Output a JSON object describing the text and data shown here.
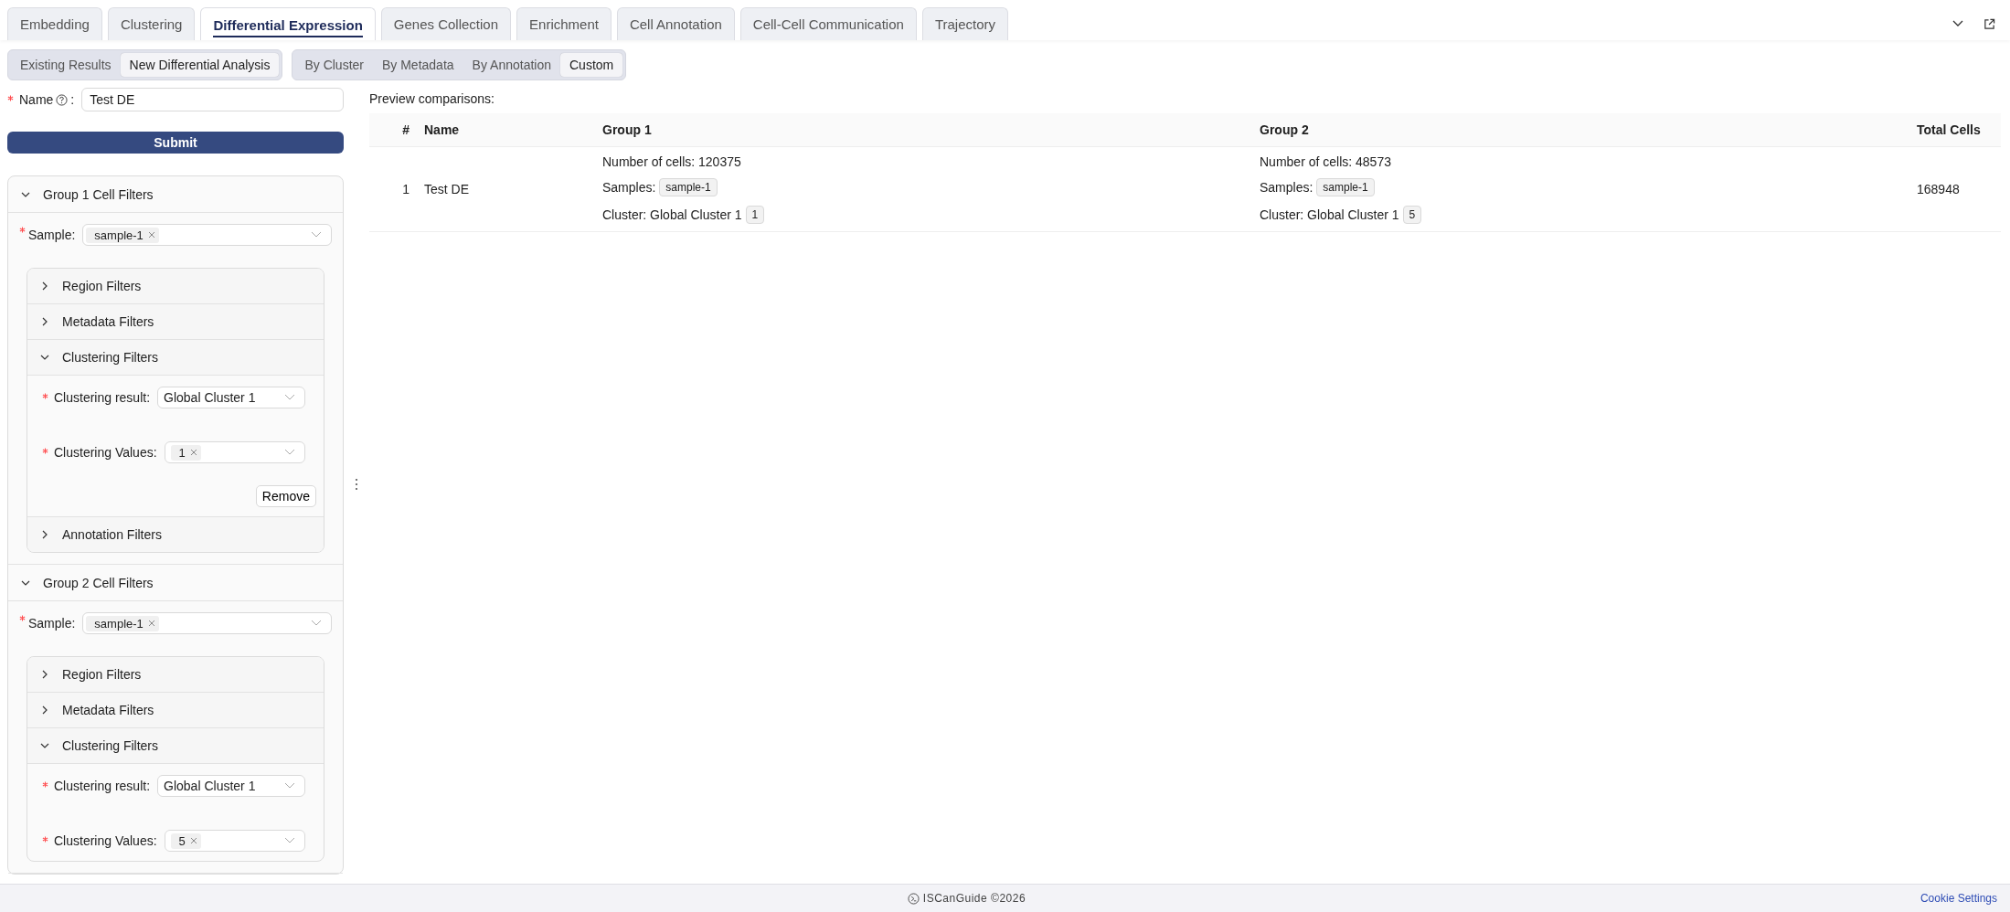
{
  "tabs": [
    {
      "label": "Embedding",
      "selected": false
    },
    {
      "label": "Clustering",
      "selected": false
    },
    {
      "label": "Differential Expression",
      "selected": true
    },
    {
      "label": "Genes Collection",
      "selected": false
    },
    {
      "label": "Enrichment",
      "selected": false
    },
    {
      "label": "Cell Annotation",
      "selected": false
    },
    {
      "label": "Cell-Cell Communication",
      "selected": false
    },
    {
      "label": "Trajectory",
      "selected": false
    }
  ],
  "mode_tabs": [
    {
      "label": "Existing Results",
      "selected": false
    },
    {
      "label": "New Differential Analysis",
      "selected": true
    }
  ],
  "method_tabs": [
    {
      "label": "By Cluster",
      "selected": false
    },
    {
      "label": "By Metadata",
      "selected": false
    },
    {
      "label": "By Annotation",
      "selected": false
    },
    {
      "label": "Custom",
      "selected": true
    }
  ],
  "form": {
    "name_label": "Name",
    "colon": ":",
    "required": true,
    "name_value": "Test DE",
    "submit": "Submit"
  },
  "groups": [
    {
      "title": "Group 1 Cell Filters",
      "expanded": true,
      "sample_label": "Sample:",
      "samples": [
        "sample-1"
      ],
      "filters": [
        {
          "title": "Region Filters",
          "expanded": false
        },
        {
          "title": "Metadata Filters",
          "expanded": false
        },
        {
          "title": "Clustering Filters",
          "expanded": true,
          "result_label": "Clustering result:",
          "result": "Global Cluster 1",
          "values_label": "Clustering Values:",
          "values": [
            "1"
          ],
          "remove": "Remove"
        },
        {
          "title": "Annotation Filters",
          "expanded": false
        }
      ]
    },
    {
      "title": "Group 2 Cell Filters",
      "expanded": true,
      "sample_label": "Sample:",
      "samples": [
        "sample-1"
      ],
      "filters": [
        {
          "title": "Region Filters",
          "expanded": false
        },
        {
          "title": "Metadata Filters",
          "expanded": false
        },
        {
          "title": "Clustering Filters",
          "expanded": true,
          "result_label": "Clustering result:",
          "result": "Global Cluster 1",
          "values_label": "Clustering Values:",
          "values": [
            "5"
          ]
        }
      ]
    }
  ],
  "preview": {
    "title": "Preview comparisons:",
    "columns": [
      "#",
      "Name",
      "Group 1",
      "Group 2",
      "Total Cells"
    ],
    "rows": [
      {
        "index": "1",
        "name": "Test DE",
        "groups": [
          {
            "cells": "Number of cells: 120375",
            "samples_label": "Samples:",
            "samples": [
              "sample-1"
            ],
            "cluster": "Cluster: Global Cluster 1",
            "cluster_values": [
              "1"
            ]
          },
          {
            "cells": "Number of cells: 48573",
            "samples_label": "Samples:",
            "samples": [
              "sample-1"
            ],
            "cluster": "Cluster: Global Cluster 1",
            "cluster_values": [
              "5"
            ]
          }
        ],
        "total": "168948"
      }
    ]
  },
  "footer": {
    "brand": "ISCanGuide ©2026",
    "link": "Cookie Settings"
  }
}
